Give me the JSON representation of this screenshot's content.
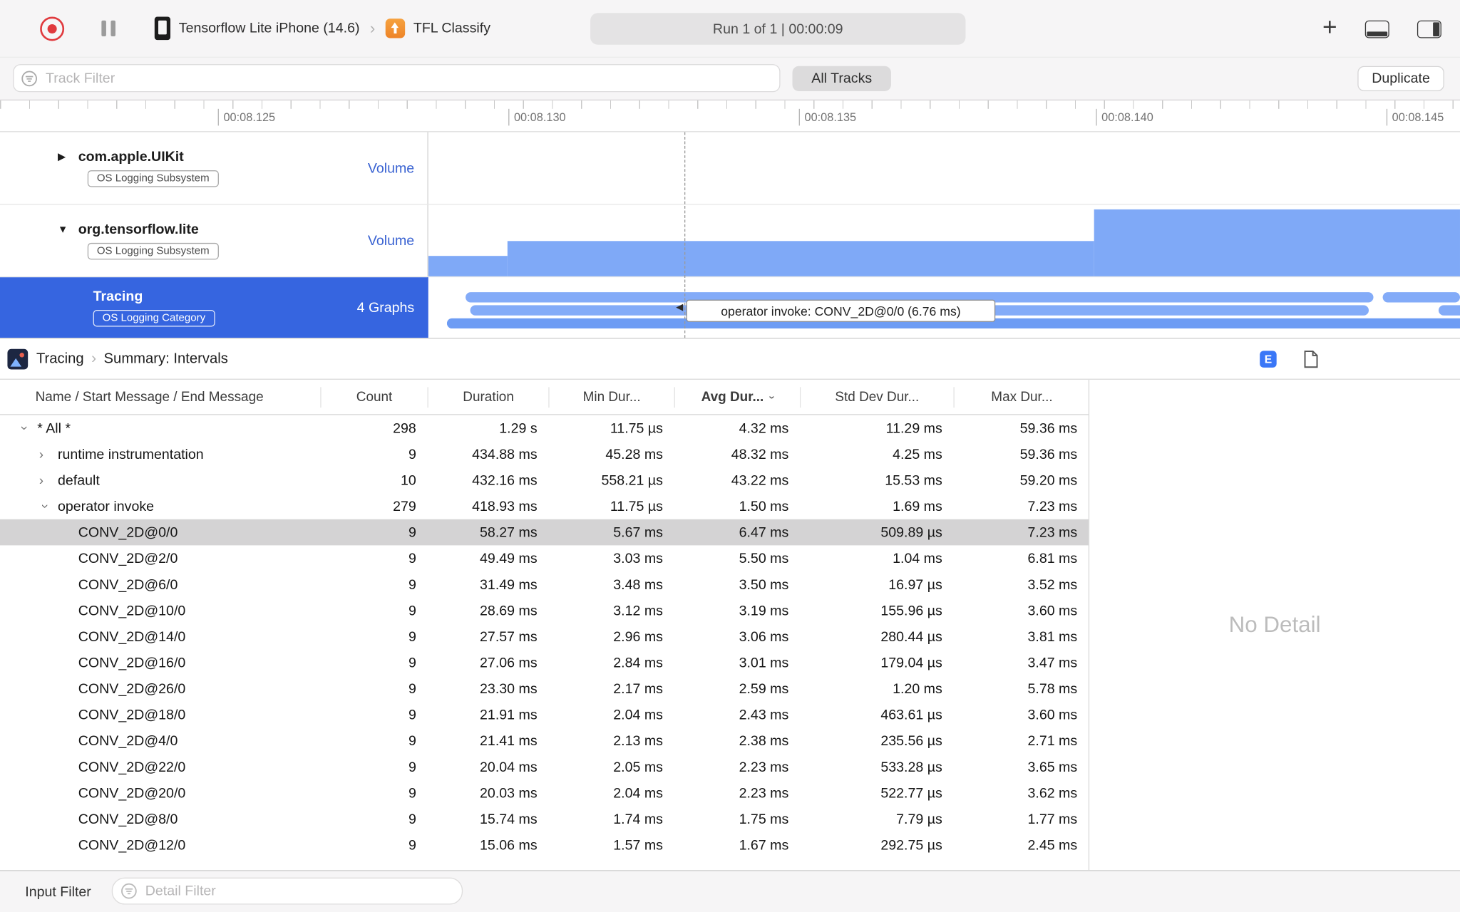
{
  "toolbar": {
    "device_name": "Tensorflow Lite iPhone (14.6)",
    "target_name": "TFL Classify",
    "run_status": "Run 1 of 1  |  00:00:09",
    "plus_label": "+"
  },
  "filter_bar": {
    "track_filter_placeholder": "Track Filter",
    "all_tracks_label": "All Tracks",
    "duplicate_label": "Duplicate"
  },
  "ruler": {
    "labels": [
      "00:08.125",
      "00:08.130",
      "00:08.135",
      "00:08.140",
      "00:08.145"
    ]
  },
  "tracks": [
    {
      "name": "com.apple.UIKit",
      "badge": "OS Logging Subsystem",
      "meta": "Volume",
      "disclosure": "collapsed"
    },
    {
      "name": "org.tensorflow.lite",
      "badge": "OS Logging Subsystem",
      "meta": "Volume",
      "disclosure": "expanded"
    },
    {
      "name": "Tracing",
      "badge": "OS Logging Category",
      "meta": "4 Graphs",
      "selected": true
    }
  ],
  "graph": {
    "tooltip": "operator invoke: CONV_2D@0/0 (6.76 ms)",
    "bar_color": "#83abf8",
    "volume_color": "#7fa9f7",
    "selected_track_color": "#3665e0"
  },
  "detail_header": {
    "breadcrumb": [
      "Tracing",
      "Summary: Intervals"
    ],
    "e_button_label": "E"
  },
  "table": {
    "columns": [
      "Name / Start Message / End Message",
      "Count",
      "Duration",
      "Min Dur...",
      "Avg Dur...",
      "Std Dev Dur...",
      "Max Dur..."
    ],
    "sorted_column": "Avg Dur...",
    "rows": [
      {
        "name": "* All *",
        "depth": 0,
        "chevron": "down",
        "count": "298",
        "duration": "1.29 s",
        "min": "11.75 µs",
        "avg": "4.32 ms",
        "std": "11.29 ms",
        "max": "59.36 ms"
      },
      {
        "name": "runtime instrumentation",
        "depth": 1,
        "chevron": "right",
        "count": "9",
        "duration": "434.88 ms",
        "min": "45.28 ms",
        "avg": "48.32 ms",
        "std": "4.25 ms",
        "max": "59.36 ms"
      },
      {
        "name": "default",
        "depth": 1,
        "chevron": "right",
        "count": "10",
        "duration": "432.16 ms",
        "min": "558.21 µs",
        "avg": "43.22 ms",
        "std": "15.53 ms",
        "max": "59.20 ms"
      },
      {
        "name": "operator invoke",
        "depth": 1,
        "chevron": "down",
        "count": "279",
        "duration": "418.93 ms",
        "min": "11.75 µs",
        "avg": "1.50 ms",
        "std": "1.69 ms",
        "max": "7.23 ms"
      },
      {
        "name": "CONV_2D@0/0",
        "depth": 2,
        "chevron": "",
        "selected": true,
        "count": "9",
        "duration": "58.27 ms",
        "min": "5.67 ms",
        "avg": "6.47 ms",
        "std": "509.89 µs",
        "max": "7.23 ms"
      },
      {
        "name": "CONV_2D@2/0",
        "depth": 2,
        "chevron": "",
        "count": "9",
        "duration": "49.49 ms",
        "min": "3.03 ms",
        "avg": "5.50 ms",
        "std": "1.04 ms",
        "max": "6.81 ms"
      },
      {
        "name": "CONV_2D@6/0",
        "depth": 2,
        "chevron": "",
        "count": "9",
        "duration": "31.49 ms",
        "min": "3.48 ms",
        "avg": "3.50 ms",
        "std": "16.97 µs",
        "max": "3.52 ms"
      },
      {
        "name": "CONV_2D@10/0",
        "depth": 2,
        "chevron": "",
        "count": "9",
        "duration": "28.69 ms",
        "min": "3.12 ms",
        "avg": "3.19 ms",
        "std": "155.96 µs",
        "max": "3.60 ms"
      },
      {
        "name": "CONV_2D@14/0",
        "depth": 2,
        "chevron": "",
        "count": "9",
        "duration": "27.57 ms",
        "min": "2.96 ms",
        "avg": "3.06 ms",
        "std": "280.44 µs",
        "max": "3.81 ms"
      },
      {
        "name": "CONV_2D@16/0",
        "depth": 2,
        "chevron": "",
        "count": "9",
        "duration": "27.06 ms",
        "min": "2.84 ms",
        "avg": "3.01 ms",
        "std": "179.04 µs",
        "max": "3.47 ms"
      },
      {
        "name": "CONV_2D@26/0",
        "depth": 2,
        "chevron": "",
        "count": "9",
        "duration": "23.30 ms",
        "min": "2.17 ms",
        "avg": "2.59 ms",
        "std": "1.20 ms",
        "max": "5.78 ms"
      },
      {
        "name": "CONV_2D@18/0",
        "depth": 2,
        "chevron": "",
        "count": "9",
        "duration": "21.91 ms",
        "min": "2.04 ms",
        "avg": "2.43 ms",
        "std": "463.61 µs",
        "max": "3.60 ms"
      },
      {
        "name": "CONV_2D@4/0",
        "depth": 2,
        "chevron": "",
        "count": "9",
        "duration": "21.41 ms",
        "min": "2.13 ms",
        "avg": "2.38 ms",
        "std": "235.56 µs",
        "max": "2.71 ms"
      },
      {
        "name": "CONV_2D@22/0",
        "depth": 2,
        "chevron": "",
        "count": "9",
        "duration": "20.04 ms",
        "min": "2.05 ms",
        "avg": "2.23 ms",
        "std": "533.28 µs",
        "max": "3.65 ms"
      },
      {
        "name": "CONV_2D@20/0",
        "depth": 2,
        "chevron": "",
        "count": "9",
        "duration": "20.03 ms",
        "min": "2.04 ms",
        "avg": "2.23 ms",
        "std": "522.77 µs",
        "max": "3.62 ms"
      },
      {
        "name": "CONV_2D@8/0",
        "depth": 2,
        "chevron": "",
        "count": "9",
        "duration": "15.74 ms",
        "min": "1.74 ms",
        "avg": "1.75 ms",
        "std": "7.79 µs",
        "max": "1.77 ms"
      },
      {
        "name": "CONV_2D@12/0",
        "depth": 2,
        "chevron": "",
        "count": "9",
        "duration": "15.06 ms",
        "min": "1.57 ms",
        "avg": "1.67 ms",
        "std": "292.75 µs",
        "max": "2.45 ms"
      }
    ]
  },
  "detail_pane": {
    "empty_label": "No Detail"
  },
  "bottom_bar": {
    "input_filter_label": "Input Filter",
    "detail_filter_placeholder": "Detail Filter"
  }
}
